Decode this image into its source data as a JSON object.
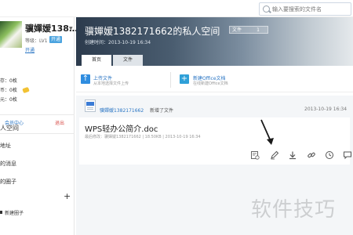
{
  "search": {
    "placeholder": "输入要搜索的文件名"
  },
  "user": {
    "name": "骥嬋嫒138…",
    "level": "等级：LV1",
    "badge": "开通",
    "open_link": "开通"
  },
  "sidebar": {
    "stats": [
      "存：0枚",
      "币：0枚",
      "元：0枚"
    ],
    "member_center": "会员中心",
    "logout": "退出",
    "items": [
      {
        "label": "人空间",
        "active": true
      },
      {
        "label": "地址"
      },
      {
        "label": "的消息"
      },
      {
        "label": "的圈子"
      }
    ],
    "group_label": "新建圈子"
  },
  "banner": {
    "title": "骥嬋嫒1382171662的私人空间",
    "created": "创建时间：2013-10-19 16:34",
    "file_label": "文件",
    "file_count": "1",
    "tabs": [
      "首页",
      "文件"
    ]
  },
  "actions": [
    {
      "title": "上传文件",
      "desc": "从本地选择文件上传",
      "icon": "upload-icon"
    },
    {
      "title": "新建Office文档",
      "desc": "在线新建Office文档",
      "icon": "plus-icon"
    }
  ],
  "feed": {
    "user": "骥嬋嫒1382171662",
    "action": "新增了文件",
    "time": "2013-10-19 16:34",
    "doc_name": "WPS轻办公简介.doc",
    "doc_meta": "最后修改：骥嬋嫒1382171662 | 18.50KB | 2013-10-19 16:34",
    "tools": [
      "history-icon",
      "edit-icon",
      "download-icon",
      "link-icon",
      "clock-icon",
      "comment-icon"
    ]
  },
  "watermark": "软件技巧",
  "colors": {
    "accent": "#2b76c4",
    "banner_dark": "#2c3b4d",
    "arrow": "#1a1a1a"
  }
}
